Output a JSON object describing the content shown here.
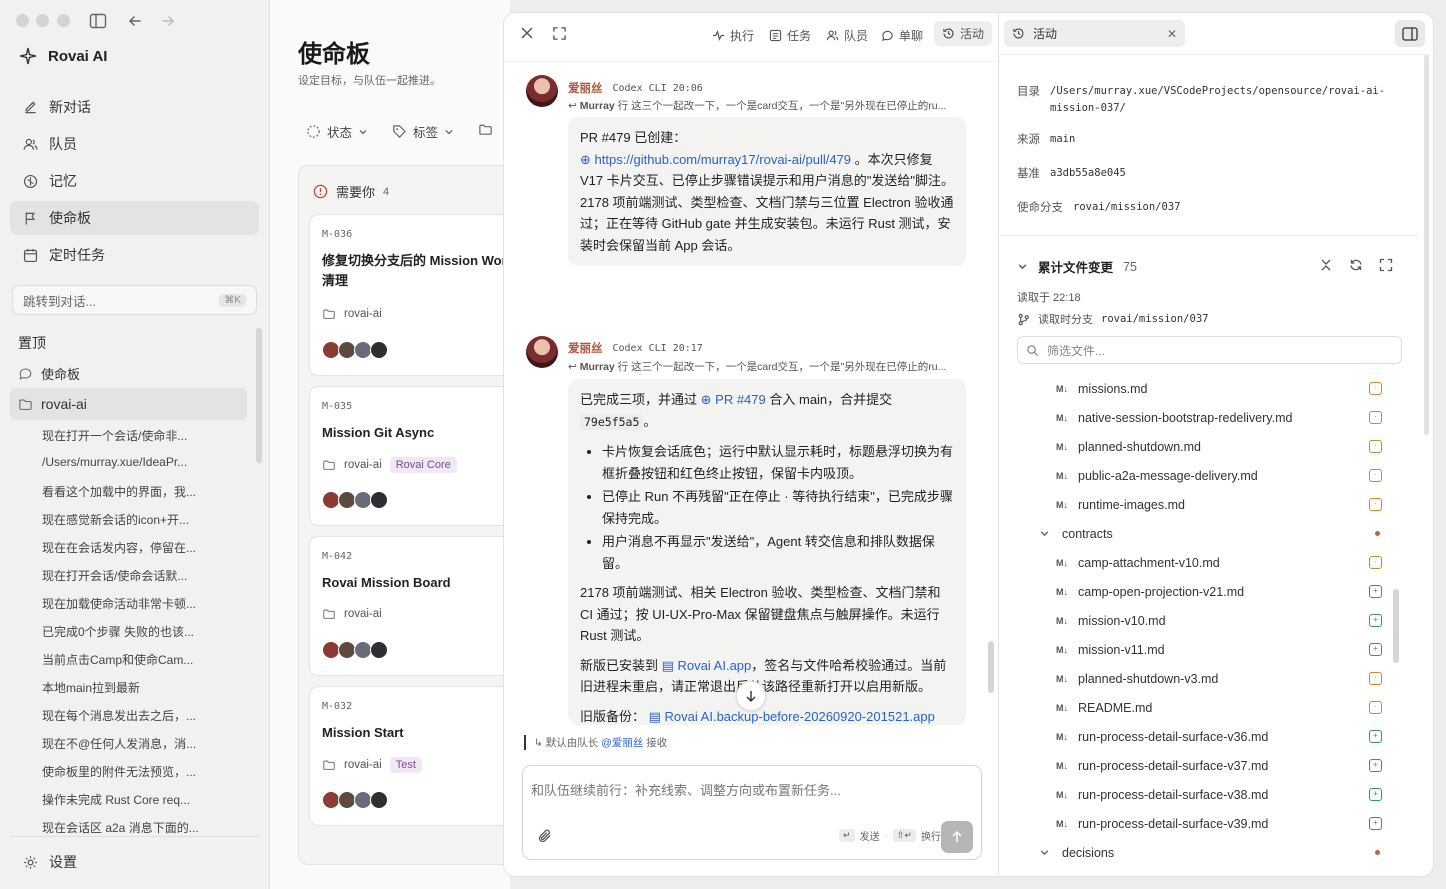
{
  "app": {
    "name": "Rovai AI"
  },
  "sidebar": {
    "nav": [
      {
        "label": "新对话"
      },
      {
        "label": "队员"
      },
      {
        "label": "记忆"
      },
      {
        "label": "使命板"
      },
      {
        "label": "定时任务"
      }
    ],
    "jump_placeholder": "跳转到对话...",
    "jump_shortcut": "⌘K",
    "pinned_title": "置顶",
    "pinned": [
      {
        "label": "使命板"
      },
      {
        "label": "rovai-ai"
      }
    ],
    "conversations": [
      "现在打开一个会话/使命非...",
      "/Users/murray.xue/IdeaPr...",
      "看看这个加载中的界面，我...",
      "现在感觉新会话的icon+开...",
      "现在在会话发内容，停留在...",
      "现在打开会话/使命会话默...",
      "现在加载使命活动非常卡顿...",
      "已完成0个步骤 失败的也该...",
      "当前点击Camp和使命Cam...",
      "本地main拉到最新",
      "现在每个消息发出去之后，...",
      "现在不@任何人发消息，消...",
      "使命板里的附件无法预览，...",
      "操作未完成 Rust Core req...",
      "现在会话区 a2a 消息下面的..."
    ],
    "settings": "设置"
  },
  "board": {
    "title": "使命板",
    "subtitle": "设定目标，与队伍一起推进。",
    "filters": [
      "状态",
      "标签"
    ],
    "column": {
      "label": "需要你",
      "count": "4"
    },
    "cards": [
      {
        "id": "M-036",
        "title": "修复切换分支后的 Mission Work 清理",
        "repo": "rovai-ai",
        "tag": ""
      },
      {
        "id": "M-035",
        "title": "Mission Git Async",
        "repo": "rovai-ai",
        "tag": "Rovai Core"
      },
      {
        "id": "M-042",
        "title": "Rovai Mission Board",
        "repo": "rovai-ai",
        "tag": ""
      },
      {
        "id": "M-032",
        "title": "Mission Start",
        "repo": "rovai-ai",
        "tag": "Test"
      }
    ]
  },
  "chat": {
    "toolbar": [
      "执行",
      "任务",
      "队员",
      "单聊",
      "活动"
    ],
    "messages": [
      {
        "author": "爱丽丝",
        "source": "Codex CLI",
        "time": "20:06",
        "reply_author": "Murray",
        "reply_text": "行 这三个一起改一下，一个是card交互，一个是\"另外现在已停止的ru...",
        "p1": "PR #479 已创建：",
        "link": "https://github.com/murray17/rovai-ai/pull/479",
        "p2": "。本次只修复 V17 卡片交互、已停止步骤错误提示和用户消息的\"发送给\"脚注。2178 项前端测试、类型检查、文档门禁与三位置 Electron 验收通过；正在等待 GitHub gate 并生成安装包。未运行 Rust 测试，安装时会保留当前 App 会话。"
      },
      {
        "author": "爱丽丝",
        "source": "Codex CLI",
        "time": "20:17",
        "reply_author": "Murray",
        "reply_text": "行 这三个一起改一下，一个是card交互，一个是\"另外现在已停止的ru...",
        "p1a": "已完成三项，并通过",
        "pr_link": "PR #479",
        "p1b": "合入 main，合并提交",
        "commit": "79e5f5a5",
        "p1c": "。",
        "bullets": [
          "卡片恢复会话底色；运行中默认显示耗时，标题悬浮切换为有框折叠按钮和红色终止按钮，保留卡内吸顶。",
          "已停止 Run 不再残留\"正在停止 · 等待执行结束\"，已完成步骤保持完成。",
          "用户消息不再显示\"发送给\"，Agent 转交信息和排队数据保留。"
        ],
        "p2": "2178 项前端测试、相关 Electron 验收、类型检查、文档门禁和 CI 通过；按 UI-UX-Pro-Max 保留键盘焦点与触屏操作。未运行 Rust 测试。",
        "p3a": "新版已安装到",
        "app_link": "Rovai AI.app",
        "p3b": "，签名与文件哈希校验通过。当前旧进程未重启，请正常退出后从该路径重新打开以启用新版。",
        "p4a": "旧版备份：",
        "backup_link": "Rovai AI.backup-before-20260920-201521.app"
      }
    ],
    "default_lead_prefix": "默认由队长",
    "default_lead_name": "@爱丽丝",
    "default_lead_suffix": "接收",
    "composer_placeholder": "和队伍继续前行：补充线索、调整方向或布置新任务...",
    "send_hint": "发送",
    "newline_hint": "换行"
  },
  "activity": {
    "tab": "活动",
    "fields": [
      {
        "label": "目录",
        "value": "/Users/murray.xue/VSCodeProjects/opensource/rovai-ai-mission-037/"
      },
      {
        "label": "来源",
        "value": "main"
      },
      {
        "label": "基准",
        "value": "a3db55a8e045"
      },
      {
        "label": "使命分支",
        "value": "rovai/mission/037"
      }
    ],
    "changes": {
      "title": "累计文件变更",
      "count": "75",
      "read_at": "读取于 22:18",
      "branch_label": "读取时分支",
      "branch": "rovai/mission/037",
      "filter_placeholder": "筛选文件...",
      "rows": [
        {
          "kind": "file",
          "name": "missions.md",
          "status": "mod"
        },
        {
          "kind": "file",
          "name": "native-session-bootstrap-redelivery.md",
          "status": "mod"
        },
        {
          "kind": "file",
          "name": "planned-shutdown.md",
          "status": "mod"
        },
        {
          "kind": "file",
          "name": "public-a2a-message-delivery.md",
          "status": "mod"
        },
        {
          "kind": "file",
          "name": "runtime-images.md",
          "status": "mod"
        },
        {
          "kind": "folder",
          "name": "contracts"
        },
        {
          "kind": "file",
          "name": "camp-attachment-v10.md",
          "status": "mod"
        },
        {
          "kind": "file",
          "name": "camp-open-projection-v21.md",
          "status": "add"
        },
        {
          "kind": "file",
          "name": "mission-v10.md",
          "status": "add"
        },
        {
          "kind": "file",
          "name": "mission-v11.md",
          "status": "add"
        },
        {
          "kind": "file",
          "name": "planned-shutdown-v3.md",
          "status": "mod"
        },
        {
          "kind": "file",
          "name": "README.md",
          "status": "mod"
        },
        {
          "kind": "file",
          "name": "run-process-detail-surface-v36.md",
          "status": "add"
        },
        {
          "kind": "file",
          "name": "run-process-detail-surface-v37.md",
          "status": "add"
        },
        {
          "kind": "file",
          "name": "run-process-detail-surface-v38.md",
          "status": "add"
        },
        {
          "kind": "file",
          "name": "run-process-detail-surface-v39.md",
          "status": "add"
        },
        {
          "kind": "folder",
          "name": "decisions"
        }
      ]
    }
  }
}
